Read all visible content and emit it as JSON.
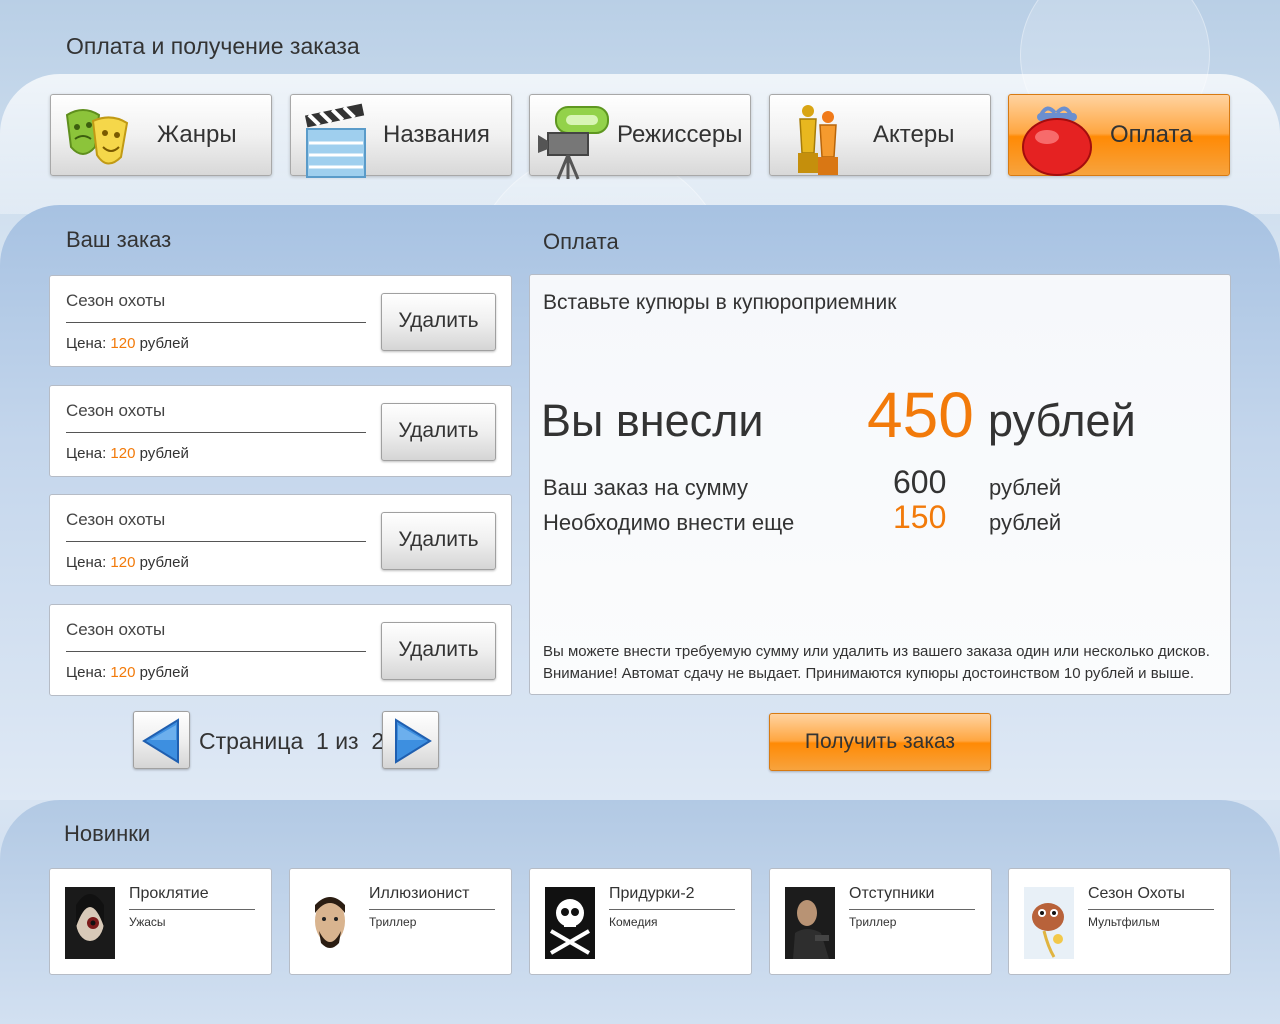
{
  "page": {
    "title": "Оплата и получение заказа"
  },
  "nav": [
    {
      "label": "Жанры",
      "icon": "theater-masks-icon",
      "active": false
    },
    {
      "label": "Названия",
      "icon": "clapperboard-icon",
      "active": false
    },
    {
      "label": "Режиссеры",
      "icon": "movie-camera-icon",
      "active": false
    },
    {
      "label": "Актеры",
      "icon": "oscar-statuette-icon",
      "active": false
    },
    {
      "label": "Оплата",
      "icon": "coin-purse-icon",
      "active": true
    }
  ],
  "order": {
    "title": "Ваш заказ",
    "items": [
      {
        "name": "Сезон охоты",
        "price_label": "Цена:",
        "price": "120",
        "currency": "рублей",
        "delete_label": "Удалить"
      },
      {
        "name": "Сезон охоты",
        "price_label": "Цена:",
        "price": "120",
        "currency": "рублей",
        "delete_label": "Удалить"
      },
      {
        "name": "Сезон охоты",
        "price_label": "Цена:",
        "price": "120",
        "currency": "рублей",
        "delete_label": "Удалить"
      },
      {
        "name": "Сезон охоты",
        "price_label": "Цена:",
        "price": "120",
        "currency": "рублей",
        "delete_label": "Удалить"
      }
    ],
    "pager": {
      "text": "Страница  1 из  2"
    }
  },
  "payment": {
    "title": "Оплата",
    "instruction": "Вставьте купюры в купюроприемник",
    "paid_label": "Вы внесли",
    "paid_amount": "450",
    "paid_unit": "рублей",
    "order_sum_label": "Ваш заказ на сумму",
    "order_sum": "600",
    "order_sum_unit": "рублей",
    "remaining_label": "Необходимо внести еще",
    "remaining": "150",
    "remaining_unit": "рублей",
    "note_line1": "Вы можете внести требуемую сумму или удалить из вашего заказа один или несколько дисков.",
    "note_line2": "Внимание! Автомат сдачу не выдает. Принимаются купюры достоинством 10 рублей и выше.",
    "get_order_label": "Получить заказ"
  },
  "new_releases": {
    "title": "Новинки",
    "items": [
      {
        "title": "Проклятие",
        "genre": "Ужасы"
      },
      {
        "title": "Иллюзионист",
        "genre": "Триллер"
      },
      {
        "title": "Придурки-2",
        "genre": "Комедия"
      },
      {
        "title": "Отступники",
        "genre": "Триллер"
      },
      {
        "title": "Сезон Охоты",
        "genre": "Мультфильм"
      }
    ]
  },
  "colors": {
    "accent": "#f27a0a",
    "active_button": "#ff8a05",
    "background": "#c6d8ec"
  }
}
